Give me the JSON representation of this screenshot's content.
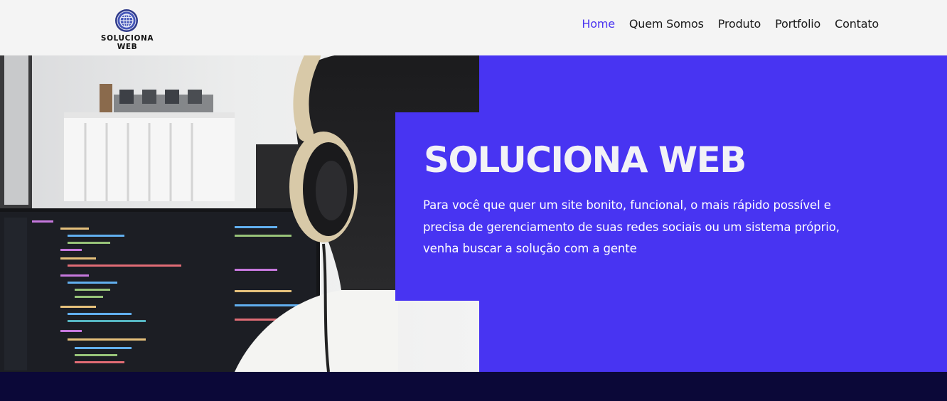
{
  "brand": {
    "name": "SOLUCIONA WEB",
    "logo_icon": "globe-icon"
  },
  "nav": {
    "items": [
      {
        "label": "Home",
        "active": true
      },
      {
        "label": "Quem Somos",
        "active": false
      },
      {
        "label": "Produto",
        "active": false
      },
      {
        "label": "Portfolio",
        "active": false
      },
      {
        "label": "Contato",
        "active": false
      }
    ]
  },
  "hero": {
    "title": "SOLUCIONA WEB",
    "lines": [
      "Para você que quer um site bonito, funcional, o mais rápido possível e",
      "precisa de gerenciamento de suas redes sociais ou um sistema próprio,",
      "venha buscar a solução com a gente"
    ],
    "image": "developer-with-headphones-coding-photo"
  },
  "colors": {
    "accent": "#4834f2",
    "nav_bg": "#f4f4f4",
    "footer_bg": "#0b0838",
    "active_link": "#4a34f0"
  }
}
